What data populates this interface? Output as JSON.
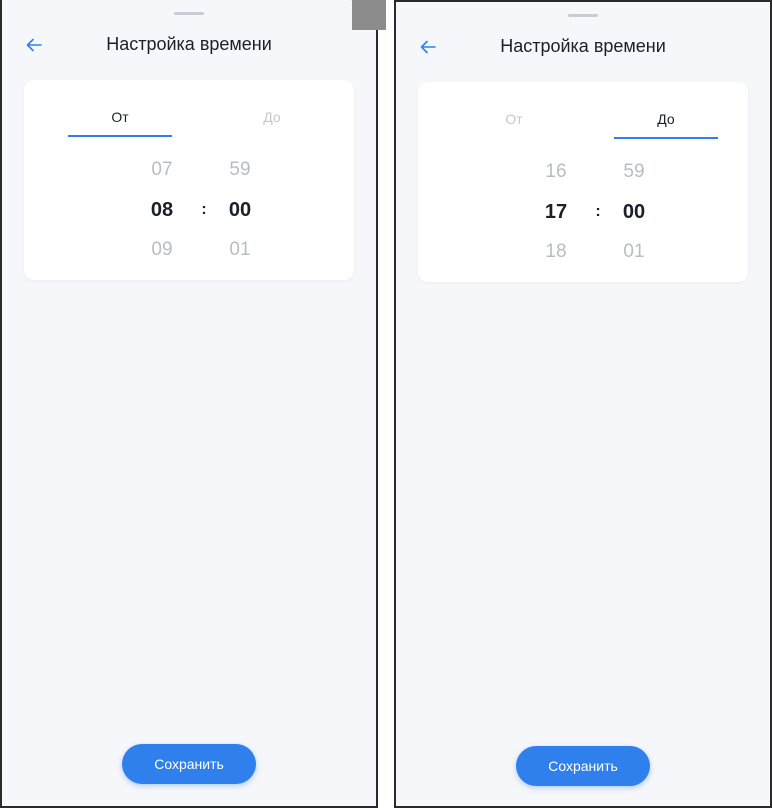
{
  "screens": [
    {
      "title": "Настройка времени",
      "active_tab": "from",
      "tabs": {
        "from": "От",
        "to": "До"
      },
      "hours": {
        "prev": "07",
        "selected": "08",
        "next": "09"
      },
      "minutes": {
        "prev": "59",
        "selected": "00",
        "next": "01"
      },
      "separator": ":",
      "save_label": "Сохранить"
    },
    {
      "title": "Настройка времени",
      "active_tab": "to",
      "tabs": {
        "from": "От",
        "to": "До"
      },
      "hours": {
        "prev": "16",
        "selected": "17",
        "next": "18"
      },
      "minutes": {
        "prev": "59",
        "selected": "00",
        "next": "01"
      },
      "separator": ":",
      "save_label": "Сохранить"
    }
  ],
  "icons": {
    "back": "arrow-left-icon"
  },
  "colors": {
    "accent": "#2f80ed",
    "background": "#f6f7fb",
    "card": "#ffffff",
    "text": "#1b1f2a",
    "muted": "#b8bcc4"
  }
}
